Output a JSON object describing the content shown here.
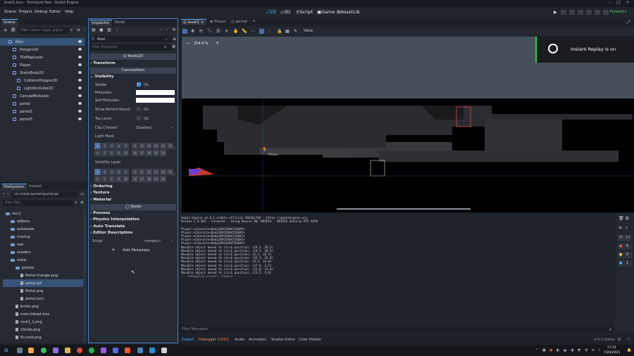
{
  "window": {
    "title": "level1.tscn - Termaure Nex - Godot Engine"
  },
  "menu": [
    "Scene",
    "Project",
    "Debug",
    "Editor",
    "Help"
  ],
  "workspaces": [
    {
      "label": "2D",
      "active": true
    },
    {
      "label": "3D",
      "active": false
    },
    {
      "label": "Script",
      "active": false
    },
    {
      "label": "Game",
      "active": false
    },
    {
      "label": "AssetLib",
      "active": false
    }
  ],
  "renderer": "Forward+",
  "scene_dock": {
    "tab": "Scene",
    "filter_placeholder": "Filter: name, t:type, g:grou",
    "nodes": [
      {
        "label": "Root",
        "selected": true,
        "color": "#8da5f3"
      },
      {
        "label": "Polygon2D",
        "selected": false,
        "color": "#8da5f3"
      },
      {
        "label": "TileMapLayer",
        "selected": false,
        "color": "#8da5f3"
      },
      {
        "label": "Player",
        "selected": false,
        "color": "#8da5f3"
      },
      {
        "label": "StaticBody2D",
        "selected": false,
        "color": "#8da5f3"
      },
      {
        "label": "CollisionPolygon2D",
        "selected": false,
        "color": "#8da5f3"
      },
      {
        "label": "LightOccluder2D",
        "selected": false,
        "color": "#8da5f3"
      },
      {
        "label": "CanvasModulate",
        "selected": false,
        "color": "#8da5f3"
      },
      {
        "label": "portal",
        "selected": false,
        "color": "#8da5f3"
      },
      {
        "label": "portal2",
        "selected": false,
        "color": "#8da5f3"
      },
      {
        "label": "portal3",
        "selected": false,
        "color": "#8da5f3"
      }
    ]
  },
  "filesystem": {
    "tabs": [
      "FileSystem",
      "Import"
    ],
    "path": "res://static/portals/portal.gd",
    "filter_placeholder": "Filter Files",
    "items": [
      {
        "label": "res://",
        "type": "folder",
        "indent": 0
      },
      {
        "label": "addons",
        "type": "folder",
        "indent": 1
      },
      {
        "label": "autoloads",
        "type": "folder",
        "indent": 1
      },
      {
        "label": "moving",
        "type": "folder",
        "indent": 1
      },
      {
        "label": "raw",
        "type": "folder",
        "indent": 1
      },
      {
        "label": "shaders",
        "type": "folder",
        "indent": 1
      },
      {
        "label": "static",
        "type": "folder",
        "indent": 1
      },
      {
        "label": "portals",
        "type": "folder",
        "indent": 2
      },
      {
        "label": "Portal triangle.png",
        "type": "file",
        "indent": 3
      },
      {
        "label": "portal.gd",
        "type": "file",
        "indent": 3,
        "selected": true
      },
      {
        "label": "Portal.png",
        "type": "file",
        "indent": 3
      },
      {
        "label": "portal.tscn",
        "type": "file",
        "indent": 3
      },
      {
        "label": "bricks.png",
        "type": "file",
        "indent": 2
      },
      {
        "label": "main-tileset.tres",
        "type": "file",
        "indent": 2
      },
      {
        "label": "rock1_1.png",
        "type": "file",
        "indent": 2
      },
      {
        "label": "cfondo.png",
        "type": "file",
        "indent": 2
      },
      {
        "label": "tls-rock.png",
        "type": "file",
        "indent": 2
      }
    ]
  },
  "inspector": {
    "tabs": [
      "Inspector",
      "Node"
    ],
    "node_name": "Root",
    "filter_placeholder": "Filter Properties",
    "class_header": "Node2D",
    "sub_header": "CanvasItem",
    "sections": {
      "transform": "Transform",
      "visibility": "Visibility",
      "ordering": "Ordering",
      "texture": "Texture",
      "material": "Material",
      "node": "Node",
      "process": "Process",
      "physics": "Physics Interpolation",
      "auto_translate": "Auto Translate",
      "editor_desc": "Editor Description"
    },
    "props": {
      "visible_label": "Visible",
      "visible_val": "On",
      "modulate_label": "Modulate",
      "self_modulate_label": "Self Modulate",
      "show_behind_label": "Show Behind Parent",
      "show_behind_val": "On",
      "top_level_label": "Top Level",
      "top_level_val": "On",
      "clip_children_label": "Clip Children",
      "clip_children_val": "Disabled",
      "light_mask_label": "Light Mask",
      "visibility_layer_label": "Visibility Layer",
      "script_label": "Script",
      "script_val": "<empty>",
      "add_metadata": "Add Metadata"
    },
    "mask_row1": [
      "1",
      "2",
      "3",
      "4",
      "5",
      "6",
      "11",
      "12",
      "13",
      "14",
      "15"
    ],
    "mask_row2": [
      "6",
      "7",
      "8",
      "9",
      "10",
      "16",
      "17",
      "18",
      "19",
      "20"
    ]
  },
  "viewport": {
    "tabs": [
      "level1",
      "Player",
      "portal"
    ],
    "zoom": "214.4 %",
    "view_menu": "View",
    "player_label": "Player"
  },
  "notification": "Instant Replay is on",
  "output": {
    "lines": [
      "Godot Engine v4.4.1.stable.official.49a5bc7b6 - https://godotengine.org",
      "Vulkan 1.4.303 - Forward+ - Using Device #0: NVIDIA - NVIDIA GeForce RTX 4070",
      "",
      "Player:<CharacterBody2D#3390d7548#1>",
      "Player:<CharacterBody2D#3390d7548#1>",
      "Player:<CharacterBody2D#3390d7548#1>",
      "Player:<CharacterBody2D#3390d7548#1>",
      "Player:<CharacterBody2D#3390d7548#1>",
      "Movable object moved to click position: (19.5, 26.5)",
      "Movable object moved to click position: (19.5, 26.5)",
      "Movable object moved to click position: (6.5, 16.5)",
      "Movable object moved to click position: (35.5, 22.0)",
      "Movable object moved to click position: (9.5, 14.0)",
      "Movable object moved to click position: (27.0, 3.5)",
      "Movable object moved to click position: (22.0, 22.0)",
      "Movable object moved to click position: (13.5, 4.0)",
      "--- Debugging process stopped ---"
    ],
    "filter_placeholder": "Filter Messages",
    "bottom_tabs": [
      "Output",
      "Debugger (1417)",
      "Audio",
      "Animation",
      "Shader Editor",
      "Color Palette"
    ],
    "version": "4.4.1.stable"
  },
  "side_counts": [
    "17",
    "6",
    "0",
    "1"
  ],
  "taskbar": {
    "time": "17:31",
    "date": "7/24/2025"
  }
}
